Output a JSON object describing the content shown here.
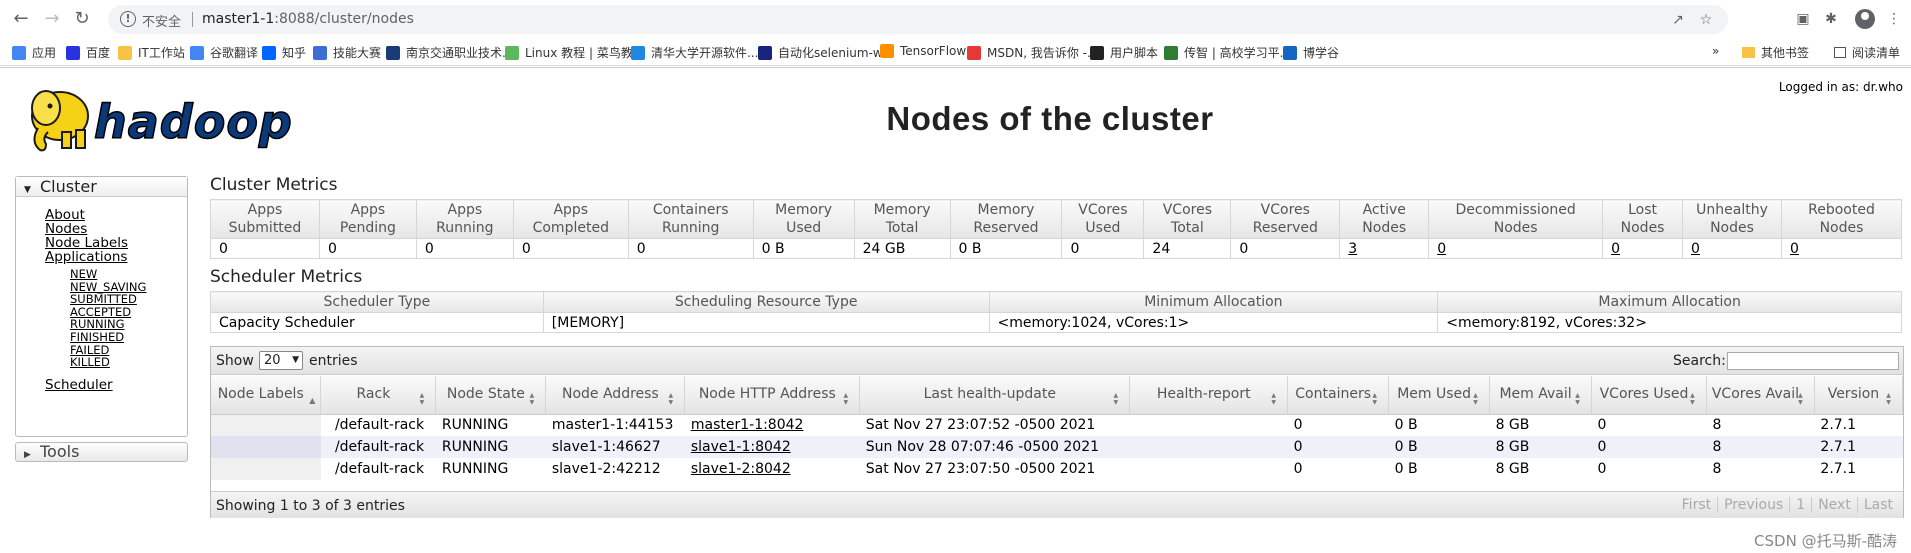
{
  "browser": {
    "insecure_label": "不安全",
    "url_host": "master1-1",
    "url_rest": ":8088/cluster/nodes",
    "bookmarks": [
      {
        "label": "应用",
        "color": "#4285f4"
      },
      {
        "label": "百度",
        "color": "#2932e1"
      },
      {
        "label": "IT工作站",
        "color": "#f6c344"
      },
      {
        "label": "谷歌翻译",
        "color": "#4285f4"
      },
      {
        "label": "知乎",
        "color": "#0066ff"
      },
      {
        "label": "技能大赛",
        "color": "#3b6fd6"
      },
      {
        "label": "南京交通职业技术...",
        "color": "#1a3a7a"
      },
      {
        "label": "Linux 教程 | 菜鸟教...",
        "color": "#5cb85c"
      },
      {
        "label": "清华大学开源软件...",
        "color": "#1e88e5"
      },
      {
        "label": "自动化selenium-w...",
        "color": "#1a237e"
      },
      {
        "label": "TensorFlow",
        "color": "#ff8f00"
      },
      {
        "label": "MSDN, 我告诉你 -...",
        "color": "#e53935"
      },
      {
        "label": "用户脚本",
        "color": "#222222"
      },
      {
        "label": "传智 | 高校学习平...",
        "color": "#2e7d32"
      },
      {
        "label": "博学谷",
        "color": "#1565c0"
      }
    ],
    "more_chevron": "»",
    "other_bookmarks": "其他书签",
    "reading_list": "阅读清单"
  },
  "header": {
    "logo_text": "hadoop",
    "title": "Nodes of the cluster",
    "logged_in": "Logged in as: dr.who"
  },
  "sidebar": {
    "cluster_label": "Cluster",
    "links": [
      "About",
      "Nodes",
      "Node Labels",
      "Applications"
    ],
    "app_states": [
      "NEW",
      "NEW_SAVING",
      "SUBMITTED",
      "ACCEPTED",
      "RUNNING",
      "FINISHED",
      "FAILED",
      "KILLED"
    ],
    "scheduler": "Scheduler",
    "tools_label": "Tools"
  },
  "cluster_metrics": {
    "title": "Cluster Metrics",
    "headers": [
      [
        "Apps",
        "Submitted"
      ],
      [
        "Apps",
        "Pending"
      ],
      [
        "Apps",
        "Running"
      ],
      [
        "Apps",
        "Completed"
      ],
      [
        "Containers",
        "Running"
      ],
      [
        "Memory",
        "Used"
      ],
      [
        "Memory",
        "Total"
      ],
      [
        "Memory",
        "Reserved"
      ],
      [
        "VCores",
        "Used"
      ],
      [
        "VCores",
        "Total"
      ],
      [
        "VCores",
        "Reserved"
      ],
      [
        "Active",
        "Nodes"
      ],
      [
        "Decommissioned",
        "Nodes"
      ],
      [
        "Lost",
        "Nodes"
      ],
      [
        "Unhealthy",
        "Nodes"
      ],
      [
        "Rebooted",
        "Nodes"
      ]
    ],
    "values": [
      "0",
      "0",
      "0",
      "0",
      "0",
      "0 B",
      "24 GB",
      "0 B",
      "0",
      "24",
      "0",
      "3",
      "0",
      "0",
      "0",
      "0"
    ]
  },
  "scheduler_metrics": {
    "title": "Scheduler Metrics",
    "headers": [
      "Scheduler Type",
      "Scheduling Resource Type",
      "Minimum Allocation",
      "Maximum Allocation"
    ],
    "values": [
      "Capacity Scheduler",
      "[MEMORY]",
      "<memory:1024, vCores:1>",
      "<memory:8192, vCores:32>"
    ]
  },
  "nodes": {
    "show_label": "Show",
    "page_size": "20",
    "entries_label": "entries",
    "search_label": "Search:",
    "headers": [
      [
        "Node Labels"
      ],
      [
        "Rack"
      ],
      [
        "Node State"
      ],
      [
        "Node Address"
      ],
      [
        "Node HTTP Address"
      ],
      [
        "Last health-update"
      ],
      [
        "Health-report"
      ],
      [
        "Containers"
      ],
      [
        "Mem Used"
      ],
      [
        "Mem Avail"
      ],
      [
        "VCores Used"
      ],
      [
        "VCores Avail"
      ],
      [
        "Version"
      ]
    ],
    "rows": [
      [
        "",
        "/default-rack",
        "RUNNING",
        "master1-1:44153",
        "master1-1:8042",
        "Sat Nov 27 23:07:52 -0500 2021",
        "",
        "0",
        "0 B",
        "8 GB",
        "0",
        "8",
        "2.7.1"
      ],
      [
        "",
        "/default-rack",
        "RUNNING",
        "slave1-1:46627",
        "slave1-1:8042",
        "Sun Nov 28 07:07:46 -0500 2021",
        "",
        "0",
        "0 B",
        "8 GB",
        "0",
        "8",
        "2.7.1"
      ],
      [
        "",
        "/default-rack",
        "RUNNING",
        "slave1-2:42212",
        "slave1-2:8042",
        "Sat Nov 27 23:07:50 -0500 2021",
        "",
        "0",
        "0 B",
        "8 GB",
        "0",
        "8",
        "2.7.1"
      ]
    ],
    "footer_info": "Showing 1 to 3 of 3 entries",
    "pager": [
      "First",
      "Previous",
      "1",
      "Next",
      "Last"
    ]
  },
  "watermark": "CSDN @托马斯-酷涛"
}
